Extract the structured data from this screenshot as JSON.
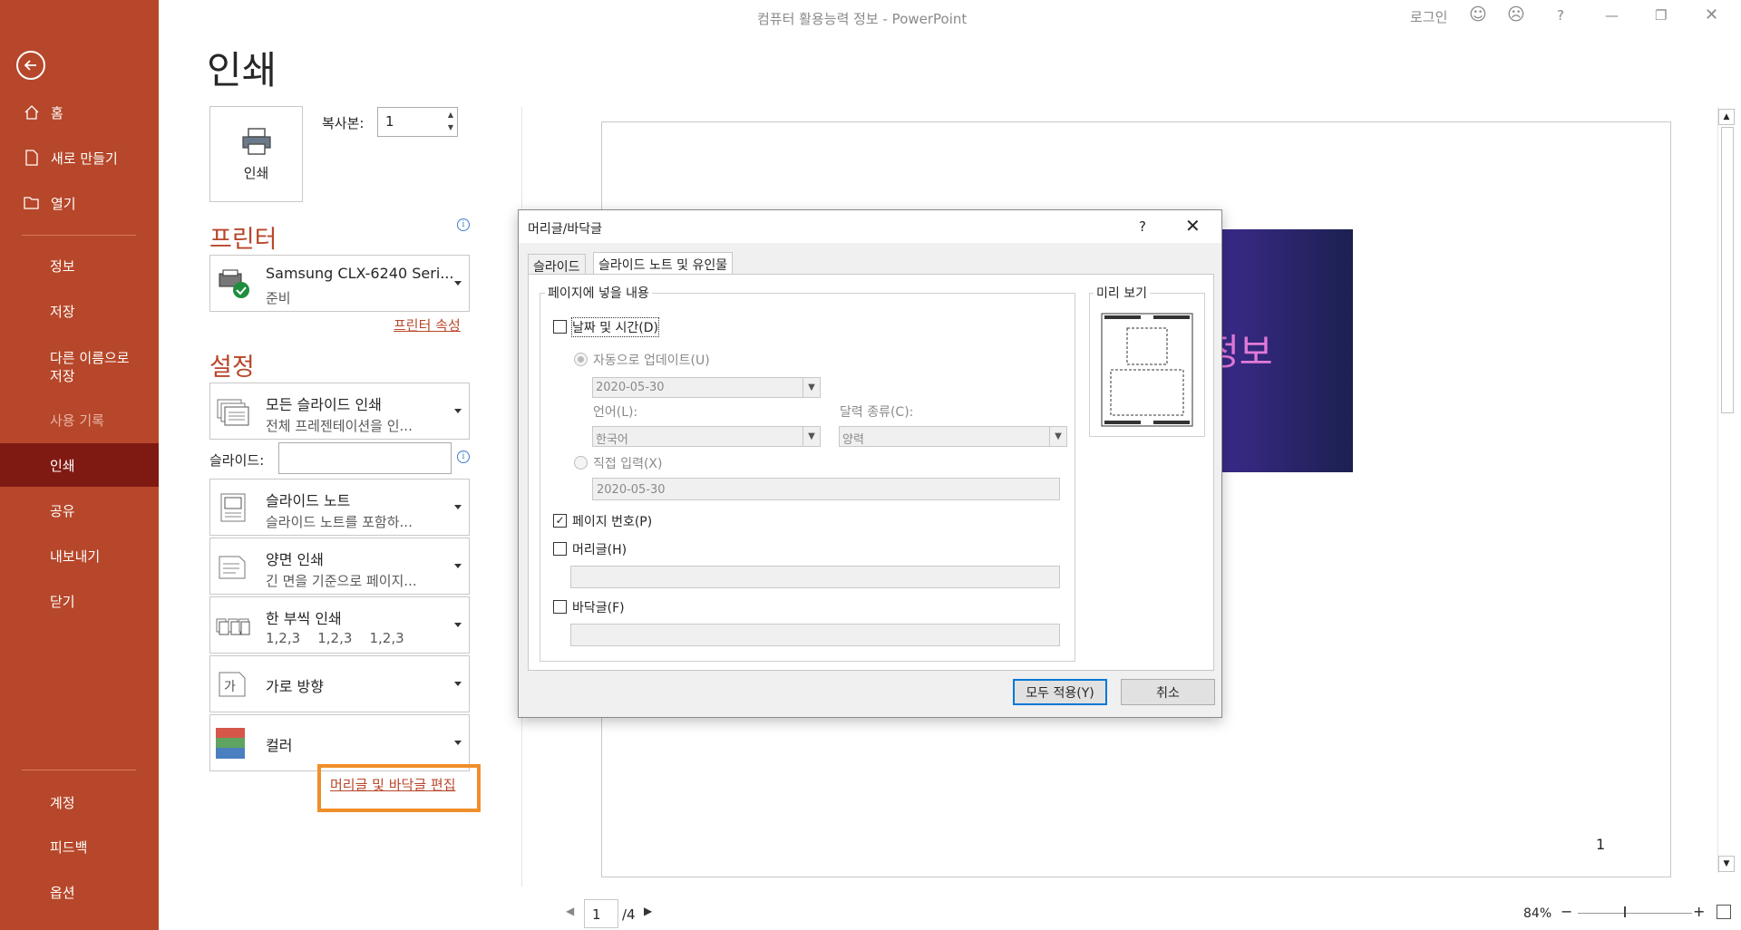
{
  "window": {
    "title": "컴퓨터 활용능력 정보 - PowerPoint",
    "sign_in": "로그인",
    "help": "?"
  },
  "sidebar": {
    "items": [
      {
        "label": "홈"
      },
      {
        "label": "새로 만들기"
      },
      {
        "label": "열기"
      },
      {
        "label": "정보"
      },
      {
        "label": "저장"
      },
      {
        "label": "다른 이름으로 저장"
      },
      {
        "label": "사용 기록"
      },
      {
        "label": "인쇄"
      },
      {
        "label": "공유"
      },
      {
        "label": "내보내기"
      },
      {
        "label": "닫기"
      },
      {
        "label": "계정"
      },
      {
        "label": "피드백"
      },
      {
        "label": "옵션"
      }
    ]
  },
  "print": {
    "heading": "인쇄",
    "print_button": "인쇄",
    "copies_label": "복사본:",
    "copies_value": "1",
    "printer_heading": "프린터",
    "printer_name": "Samsung CLX-6240 Seri...",
    "printer_status": "준비",
    "printer_props_link": "프린터 속성",
    "settings_heading": "설정",
    "setting_range_title": "모든 슬라이드 인쇄",
    "setting_range_desc": "전체 프레젠테이션을 인...",
    "slides_label": "슬라이드:",
    "setting_layout_title": "슬라이드 노트",
    "setting_layout_desc": "슬라이드 노트를 포함하...",
    "setting_duplex_title": "양면 인쇄",
    "setting_duplex_desc": "긴 면을 기준으로 페이지...",
    "setting_collate_title": "한 부씩 인쇄",
    "setting_collate_desc": "1,2,3    1,2,3    1,2,3",
    "setting_orientation": "가로 방향",
    "setting_color": "컬러",
    "header_footer_link": "머리글 및 바닥글 편집"
  },
  "preview": {
    "slide_title_partial": "정보",
    "page_number": "1",
    "current_page": "1",
    "total_pages": "/4",
    "zoom": "84%"
  },
  "dialog": {
    "title": "머리글/바닥글",
    "help": "?",
    "tabs": [
      {
        "label": "슬라이드"
      },
      {
        "label": "슬라이드 노트 및 유인물"
      }
    ],
    "group_title": "페이지에 넣을 내용",
    "date_time_label": "날짜 및 시간(D)",
    "date_time_checked": false,
    "auto_update_label": "자동으로 업데이트(U)",
    "auto_update_value": "2020-05-30",
    "language_label": "언어(L):",
    "language_value": "한국어",
    "calendar_label": "달력 종류(C):",
    "calendar_value": "양력",
    "fixed_label": "직접 입력(X)",
    "fixed_value": "2020-05-30",
    "page_number_label": "페이지 번호(P)",
    "page_number_checked": true,
    "header_label": "머리글(H)",
    "header_checked": false,
    "footer_label": "바닥글(F)",
    "footer_checked": false,
    "preview_title": "미리 보기",
    "apply_all_button": "모두 적용(Y)",
    "cancel_button": "취소"
  },
  "colors": {
    "accent": "#b7472a",
    "highlight": "#f08e2a"
  }
}
